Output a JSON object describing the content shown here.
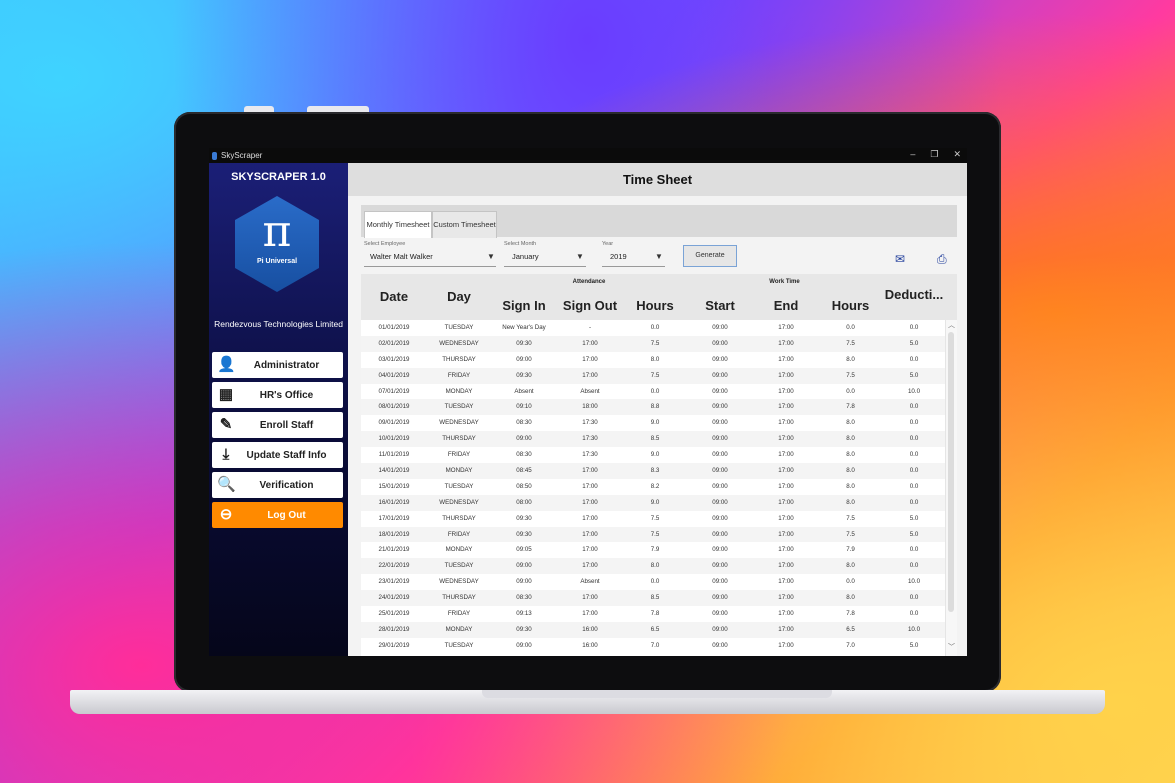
{
  "window": {
    "title": "SkyScraper",
    "controls": [
      "–",
      "❐",
      "✕"
    ]
  },
  "sidebar": {
    "title": "SKYSCRAPER 1.0",
    "logo_symbol": "π",
    "logo_text": "Pi Universal",
    "company": "Rendezvous Technologies Limited",
    "items": [
      {
        "label": "Administrator",
        "icon": "admin-icon",
        "glyph": "👤"
      },
      {
        "label": "HR's Office",
        "icon": "office-icon",
        "glyph": "▦"
      },
      {
        "label": "Enroll Staff",
        "icon": "enroll-icon",
        "glyph": "✎"
      },
      {
        "label": "Update Staff Info",
        "icon": "download-icon",
        "glyph": "⤓"
      },
      {
        "label": "Verification",
        "icon": "verification-icon",
        "glyph": "🔍"
      },
      {
        "label": "Log Out",
        "icon": "logout-icon",
        "glyph": "⊖"
      }
    ]
  },
  "main": {
    "title": "Time Sheet",
    "tabs": [
      "Monthly Timesheet",
      "Custom Timesheet"
    ],
    "employee": {
      "label": "Select Employee",
      "value": "Walter Malt Walker"
    },
    "month": {
      "label": "Select Month",
      "value": "January"
    },
    "year": {
      "label": "Year",
      "value": "2019"
    },
    "generate_label": "Generate",
    "icons": {
      "mail": "mail-icon",
      "print": "print-icon"
    }
  },
  "table": {
    "headers": {
      "date": "Date",
      "day": "Day",
      "attendance": "Attendance",
      "sign_in": "Sign In",
      "sign_out": "Sign Out",
      "hours": "Hours",
      "work_time": "Work Time",
      "start": "Start",
      "end": "End",
      "work_hours": "Hours",
      "deduction": "Deducti..."
    },
    "rows": [
      [
        "01/01/2019",
        "TUESDAY",
        "New Year's Day",
        "-",
        "0.0",
        "09:00",
        "17:00",
        "0.0",
        "0.0"
      ],
      [
        "02/01/2019",
        "WEDNESDAY",
        "09:30",
        "17:00",
        "7.5",
        "09:00",
        "17:00",
        "7.5",
        "5.0"
      ],
      [
        "03/01/2019",
        "THURSDAY",
        "09:00",
        "17:00",
        "8.0",
        "09:00",
        "17:00",
        "8.0",
        "0.0"
      ],
      [
        "04/01/2019",
        "FRIDAY",
        "09:30",
        "17:00",
        "7.5",
        "09:00",
        "17:00",
        "7.5",
        "5.0"
      ],
      [
        "07/01/2019",
        "MONDAY",
        "Absent",
        "Absent",
        "0.0",
        "09:00",
        "17:00",
        "0.0",
        "10.0"
      ],
      [
        "08/01/2019",
        "TUESDAY",
        "09:10",
        "18:00",
        "8.8",
        "09:00",
        "17:00",
        "7.8",
        "0.0"
      ],
      [
        "09/01/2019",
        "WEDNESDAY",
        "08:30",
        "17:30",
        "9.0",
        "09:00",
        "17:00",
        "8.0",
        "0.0"
      ],
      [
        "10/01/2019",
        "THURSDAY",
        "09:00",
        "17:30",
        "8.5",
        "09:00",
        "17:00",
        "8.0",
        "0.0"
      ],
      [
        "11/01/2019",
        "FRIDAY",
        "08:30",
        "17:30",
        "9.0",
        "09:00",
        "17:00",
        "8.0",
        "0.0"
      ],
      [
        "14/01/2019",
        "MONDAY",
        "08:45",
        "17:00",
        "8.3",
        "09:00",
        "17:00",
        "8.0",
        "0.0"
      ],
      [
        "15/01/2019",
        "TUESDAY",
        "08:50",
        "17:00",
        "8.2",
        "09:00",
        "17:00",
        "8.0",
        "0.0"
      ],
      [
        "16/01/2019",
        "WEDNESDAY",
        "08:00",
        "17:00",
        "9.0",
        "09:00",
        "17:00",
        "8.0",
        "0.0"
      ],
      [
        "17/01/2019",
        "THURSDAY",
        "09:30",
        "17:00",
        "7.5",
        "09:00",
        "17:00",
        "7.5",
        "5.0"
      ],
      [
        "18/01/2019",
        "FRIDAY",
        "09:30",
        "17:00",
        "7.5",
        "09:00",
        "17:00",
        "7.5",
        "5.0"
      ],
      [
        "21/01/2019",
        "MONDAY",
        "09:05",
        "17:00",
        "7.9",
        "09:00",
        "17:00",
        "7.9",
        "0.0"
      ],
      [
        "22/01/2019",
        "TUESDAY",
        "09:00",
        "17:00",
        "8.0",
        "09:00",
        "17:00",
        "8.0",
        "0.0"
      ],
      [
        "23/01/2019",
        "WEDNESDAY",
        "09:00",
        "Absent",
        "0.0",
        "09:00",
        "17:00",
        "0.0",
        "10.0"
      ],
      [
        "24/01/2019",
        "THURSDAY",
        "08:30",
        "17:00",
        "8.5",
        "09:00",
        "17:00",
        "8.0",
        "0.0"
      ],
      [
        "25/01/2019",
        "FRIDAY",
        "09:13",
        "17:00",
        "7.8",
        "09:00",
        "17:00",
        "7.8",
        "0.0"
      ],
      [
        "28/01/2019",
        "MONDAY",
        "09:30",
        "16:00",
        "6.5",
        "09:00",
        "17:00",
        "6.5",
        "10.0"
      ],
      [
        "29/01/2019",
        "TUESDAY",
        "09:00",
        "16:00",
        "7.0",
        "09:00",
        "17:00",
        "7.0",
        "5.0"
      ]
    ]
  },
  "colors": {
    "sidebar": "#1b1f77",
    "logout": "#ff8a00",
    "accent": "#1d3b9a"
  }
}
